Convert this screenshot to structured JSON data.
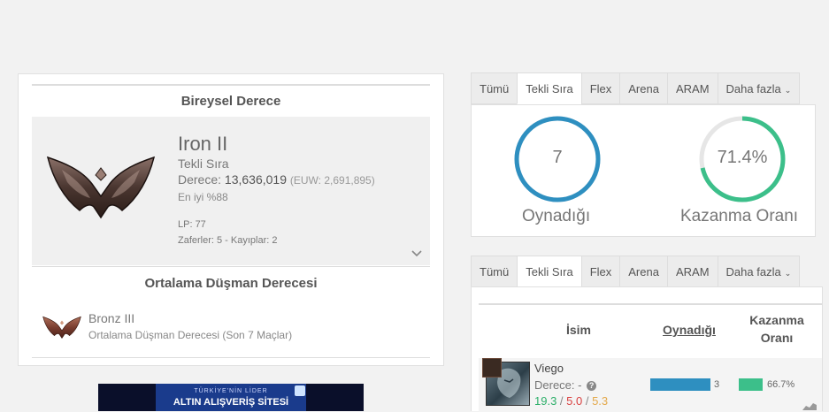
{
  "ranked_section": {
    "title": "Bireysel Derece",
    "tier": "Iron II",
    "queue": "Tekli Sıra",
    "ladder_label": "Derece:",
    "ladder_rank": "13,636,019",
    "region_rank": "(EUW: 2,691,895)",
    "best": "En iyi %88",
    "lp": "LP: 77",
    "wins_losses": "Zaferler: 5 - Kayıplar: 2"
  },
  "avg_section": {
    "title": "Ortalama Düşman Derecesi",
    "tier": "Bronz III",
    "subtitle": "Ortalama Düşman Derecesi (Son 7 Maçlar)"
  },
  "tabs_top": {
    "items": [
      "Tümü",
      "Tekli Sıra",
      "Flex",
      "Arena",
      "ARAM",
      "Daha fazla"
    ],
    "active": 1
  },
  "stats": {
    "played_value": "7",
    "played_label": "Oynadığı",
    "winrate_value": "71.4%",
    "winrate_label": "Kazanma Oranı",
    "winrate_fraction": 0.714,
    "played_fraction": 1.0,
    "played_color": "#2e8fc0",
    "winrate_color": "#3cbf8a"
  },
  "tabs_bottom": {
    "items": [
      "Tümü",
      "Tekli Sıra",
      "Flex",
      "Arena",
      "ARAM",
      "Daha fazla"
    ],
    "active": 1
  },
  "champions": {
    "col_name": "İsim",
    "col_played": "Oynadığı",
    "col_winrate_1": "Kazanma",
    "col_winrate_2": "Oranı",
    "rows": [
      {
        "name": "Viego",
        "rank": "Derece: -",
        "kills": "19.3",
        "deaths": "5.0",
        "assists": "5.3",
        "played": "3",
        "played_fraction": 1.0,
        "winrate": "66.7%",
        "winrate_fraction": 1.0
      }
    ]
  },
  "ad": {
    "line1": "TÜRKİYE'NİN LİDER",
    "line2": "ALTIN ALIŞVERİŞ SİTESİ"
  }
}
